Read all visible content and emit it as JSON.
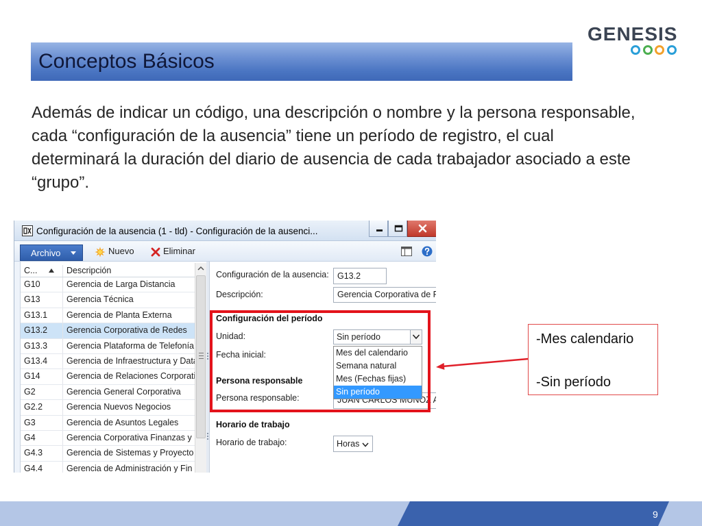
{
  "theme": {
    "title-bar-top": "#97b4e4",
    "title-bar-bottom": "#3f69b8",
    "title-text": "#0f1738",
    "body-text": "#262626",
    "highlight-red": "#e3131b",
    "callout-border": "#e04848",
    "arrow-red": "#e0202a",
    "footer-light": "#b4c6e6",
    "footer-dark": "#3a62ad",
    "list-selection": "#3399ff",
    "grid-selection": "#cde3f7",
    "file-button": "#2f5eab"
  },
  "slide": {
    "title": "Conceptos Básicos",
    "logo": {
      "text": "GENESIS",
      "circle_colors": [
        "#2a9fd8",
        "#4caf50",
        "#f2a12c",
        "#2a9fd8"
      ]
    },
    "body_lines": [
      "Además de indicar un código, una descripción o nombre y la persona responsable,",
      "cada “configuración de la ausencia” tiene un período de registro, el cual",
      "determinará la duración del diario de ausencia de cada trabajador asociado a este",
      "“grupo”."
    ],
    "callout": {
      "lines": [
        "-Mes calendario",
        "-Sin período"
      ]
    },
    "page_number": "9"
  },
  "window": {
    "title": "Configuración de la ausencia (1 - tld) - Configuración de la ausenci...",
    "icons": {
      "app": "dynamics-ax-icon",
      "new": "new-star-icon",
      "delete": "delete-x-icon",
      "layout": "layout-icon",
      "help": "help-icon"
    },
    "action_pane": {
      "file_label": "Archivo",
      "new_label": "Nuevo",
      "delete_label": "Eliminar"
    },
    "grid": {
      "columns": [
        "C...",
        "Descripción"
      ],
      "selected_index": 3,
      "rows": [
        {
          "code": "G10",
          "description": "Gerencia de Larga Distancia"
        },
        {
          "code": "G13",
          "description": "Gerencia Técnica"
        },
        {
          "code": "G13.1",
          "description": "Gerencia de Planta Externa"
        },
        {
          "code": "G13.2",
          "description": "Gerencia Corporativa de Redes"
        },
        {
          "code": "G13.3",
          "description": "Gerencia Plataforma de Telefonía"
        },
        {
          "code": "G13.4",
          "description": "Gerencia de Infraestructura y Data"
        },
        {
          "code": "G14",
          "description": "Gerencia de Relaciones Corporati"
        },
        {
          "code": "G2",
          "description": "Gerencia General Corporativa"
        },
        {
          "code": "G2.2",
          "description": "Gerencia Nuevos Negocios"
        },
        {
          "code": "G3",
          "description": "Gerencia de Asuntos Legales"
        },
        {
          "code": "G4",
          "description": "Gerencia Corporativa Finanzas y S"
        },
        {
          "code": "G4.3",
          "description": "Gerencia de Sistemas y Proyecto I"
        },
        {
          "code": "G4.4",
          "description": "Gerencia de Administración y Fin"
        }
      ]
    },
    "detail": {
      "absence_config_label": "Configuración de la ausencia:",
      "absence_config_value": "G13.2",
      "description_label": "Descripción:",
      "description_value": "Gerencia Corporativa de R",
      "period_section": "Configuración del período",
      "unit_label": "Unidad:",
      "unit_value": "Sin período",
      "start_date_label": "Fecha inicial:",
      "unit_options": [
        "Mes del calendario",
        "Semana natural",
        "Mes (Fechas fijas)",
        "Sin período"
      ],
      "unit_selected_index": 3,
      "responsible_section": "Persona responsable",
      "responsible_label": "Persona responsable:",
      "responsible_value": "JUAN CARLOS MUÑOZ AC",
      "schedule_section": "Horario de trabajo",
      "schedule_label": "Horario de trabajo:",
      "schedule_value": "Horas"
    }
  }
}
